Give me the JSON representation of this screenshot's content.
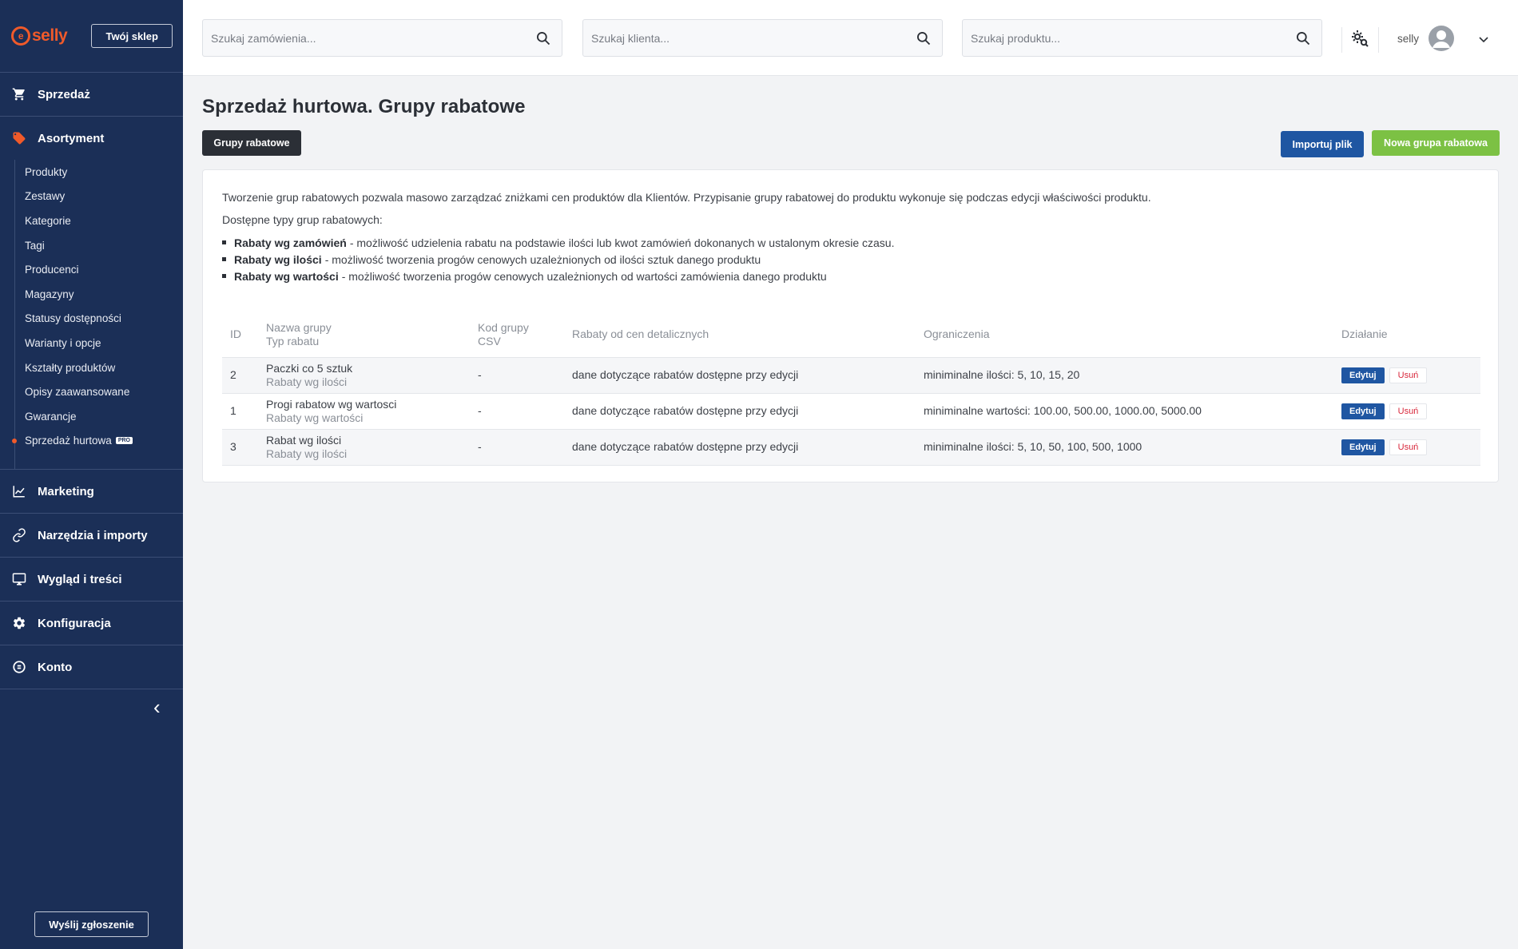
{
  "brand": {
    "logo_text": "selly",
    "logo_mark": "e",
    "shop_button": "Twój sklep",
    "accent": "#f05a2a",
    "sidebar_bg": "#1b2f57"
  },
  "sidebar": {
    "sections": [
      {
        "label": "Sprzedaż",
        "icon": "cart-icon"
      },
      {
        "label": "Asortyment",
        "icon": "tag-icon"
      },
      {
        "label": "Marketing",
        "icon": "chart-icon"
      },
      {
        "label": "Narzędzia i importy",
        "icon": "link-icon"
      },
      {
        "label": "Wygląd i treści",
        "icon": "monitor-icon"
      },
      {
        "label": "Konfiguracja",
        "icon": "gear-icon"
      },
      {
        "label": "Konto",
        "icon": "account-icon"
      }
    ],
    "assortment_items": [
      "Produkty",
      "Zestawy",
      "Kategorie",
      "Tagi",
      "Producenci",
      "Magazyny",
      "Statusy dostępności",
      "Warianty i opcje",
      "Kształty produktów",
      "Opisy zaawansowane",
      "Gwarancje",
      "Sprzedaż hurtowa"
    ],
    "pro_badge": "PRO",
    "collapse_glyph": "‹",
    "report_button": "Wyślij zgłoszenie"
  },
  "topbar": {
    "search_orders_placeholder": "Szukaj zamówienia...",
    "search_clients_placeholder": "Szukaj klienta...",
    "search_products_placeholder": "Szukaj produktu...",
    "username": "selly"
  },
  "page": {
    "title": "Sprzedaż hurtowa. Grupy rabatowe",
    "tab_button": "Grupy rabatowe",
    "import_button": "Importuj plik",
    "new_group_button": "Nowa grupa rabatowa",
    "intro": "Tworzenie grup rabatowych pozwala masowo zarządzać zniżkami cen produktów dla Klientów. Przypisanie grupy rabatowej do produktu wykonuje się podczas edycji właściwości produktu.",
    "types_title": "Dostępne typy grup rabatowych:",
    "types": [
      {
        "name": "Rabaty wg zamówień",
        "desc": "- możliwość udzielenia rabatu na podstawie ilości lub kwot zamówień dokonanych w ustalonym okresie czasu."
      },
      {
        "name": "Rabaty wg ilości",
        "desc": "- możliwość tworzenia progów cenowych uzależnionych od ilości sztuk danego produktu"
      },
      {
        "name": "Rabaty wg wartości",
        "desc": "- możliwość tworzenia progów cenowych uzależnionych od wartości zamówienia danego produktu"
      }
    ]
  },
  "table": {
    "headers": {
      "id": "ID",
      "name": "Nazwa grupy",
      "type": "Typ rabatu",
      "csv1": "Kod grupy",
      "csv2": "CSV",
      "discounts": "Rabaty od cen detalicznych",
      "limits": "Ograniczenia",
      "action": "Działanie"
    },
    "rows": [
      {
        "id": "2",
        "name": "Paczki co 5 sztuk",
        "type": "Rabaty wg ilości",
        "csv": "-",
        "discounts": "dane dotyczące rabatów dostępne przy edycji",
        "limits": "miniminalne ilości: 5, 10, 15, 20",
        "edit": "Edytuj",
        "delete": "Usuń"
      },
      {
        "id": "1",
        "name": "Progi rabatow wg wartosci",
        "type": "Rabaty wg wartości",
        "csv": "-",
        "discounts": "dane dotyczące rabatów dostępne przy edycji",
        "limits": "miniminalne wartości: 100.00, 500.00, 1000.00, 5000.00",
        "edit": "Edytuj",
        "delete": "Usuń"
      },
      {
        "id": "3",
        "name": "Rabat wg ilości",
        "type": "Rabaty wg ilości",
        "csv": "-",
        "discounts": "dane dotyczące rabatów dostępne przy edycji",
        "limits": "miniminalne ilości: 5, 10, 50, 100, 500, 1000",
        "edit": "Edytuj",
        "delete": "Usuń"
      }
    ]
  }
}
